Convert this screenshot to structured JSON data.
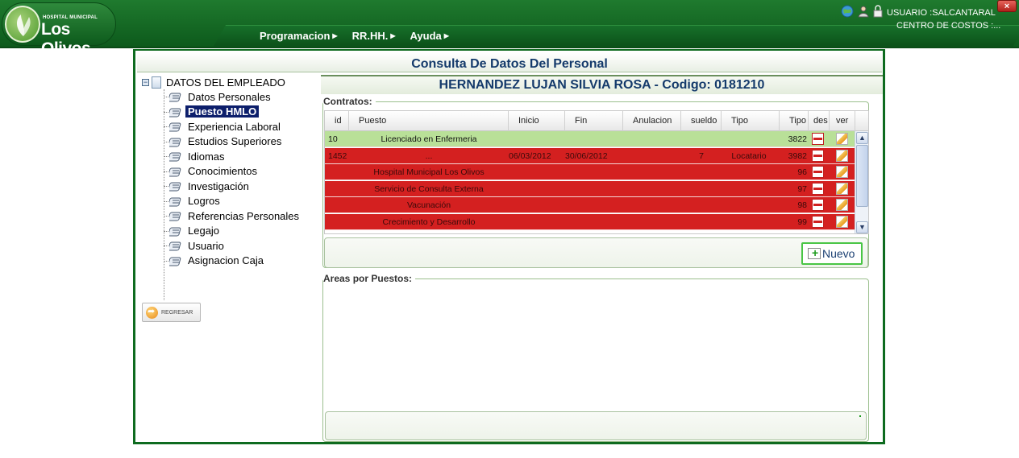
{
  "app": {
    "logo_top": "HOSPITAL MUNICIPAL",
    "logo_main": "Los Olivos"
  },
  "menu": [
    {
      "label": "Programacion"
    },
    {
      "label": "RR.HH."
    },
    {
      "label": "Ayuda"
    }
  ],
  "user": {
    "user_line": "USUARIO :SALCANTARAL",
    "cost_line": "CENTRO DE COSTOS :...",
    "close_label": "×"
  },
  "page": {
    "title": "Consulta De Datos Del Personal",
    "employee_title": "HERNANDEZ LUJAN SILVIA ROSA - Codigo: 0181210"
  },
  "tree": {
    "root_label": "DATOS DEL EMPLEADO",
    "items": [
      {
        "label": "Datos Personales"
      },
      {
        "label": "Puesto HMLO",
        "selected": true
      },
      {
        "label": "Experiencia Laboral"
      },
      {
        "label": "Estudios Superiores"
      },
      {
        "label": "Idiomas"
      },
      {
        "label": "Conocimientos"
      },
      {
        "label": "Investigación"
      },
      {
        "label": "Logros"
      },
      {
        "label": "Referencias Personales"
      },
      {
        "label": "Legajo"
      },
      {
        "label": "Usuario"
      },
      {
        "label": "Asignacion Caja"
      }
    ],
    "back_label": "REGRESAR"
  },
  "contracts": {
    "legend": "Contratos:",
    "columns": [
      "id",
      "Puesto",
      "Inicio",
      "Fin",
      "Anulacion",
      "sueldo",
      "Tipo",
      "Tipo",
      "des",
      "ver"
    ],
    "rows": [
      {
        "id": "10",
        "puesto": "Licenciado en Enfermeria",
        "inicio": "",
        "fin": "",
        "anulacion": "",
        "sueldo": "",
        "tipo": "",
        "tipo2": "3822",
        "status": "green"
      },
      {
        "id": "1452",
        "puesto": "...",
        "inicio": "06/03/2012",
        "fin": "30/06/2012",
        "anulacion": "",
        "sueldo": "7",
        "tipo": "Locatario",
        "tipo2": "3982",
        "status": "red"
      },
      {
        "id": "",
        "puesto": "Hospital Municipal Los Olivos",
        "inicio": "",
        "fin": "",
        "anulacion": "",
        "sueldo": "",
        "tipo": "",
        "tipo2": "96",
        "status": "red"
      },
      {
        "id": "",
        "puesto": "Servicio de Consulta Externa",
        "inicio": "",
        "fin": "",
        "anulacion": "",
        "sueldo": "",
        "tipo": "",
        "tipo2": "97",
        "status": "red"
      },
      {
        "id": "",
        "puesto": "Vacunación",
        "inicio": "",
        "fin": "",
        "anulacion": "",
        "sueldo": "",
        "tipo": "",
        "tipo2": "98",
        "status": "red"
      },
      {
        "id": "",
        "puesto": "Crecimiento y Desarrollo",
        "inicio": "",
        "fin": "",
        "anulacion": "",
        "sueldo": "",
        "tipo": "",
        "tipo2": "99",
        "status": "red"
      }
    ],
    "new_label": "Nuevo"
  },
  "areas": {
    "legend": "Areas por Puestos:"
  },
  "colors": {
    "header_green": "#0d5a1c",
    "row_green": "#b9e098",
    "row_red": "#d42020",
    "title_blue": "#143a6b"
  }
}
